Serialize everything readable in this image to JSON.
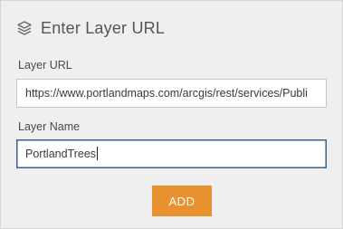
{
  "header": {
    "icon": "layers-icon",
    "title": "Enter Layer URL"
  },
  "form": {
    "url_label": "Layer URL",
    "url_value": "https://www.portlandmaps.com/arcgis/rest/services/Publi",
    "name_label": "Layer Name",
    "name_value": "PortlandTrees"
  },
  "actions": {
    "add_label": "ADD"
  },
  "colors": {
    "panel_background": "#efefef",
    "accent_button": "#e8922f",
    "focused_border": "#3b5f8f"
  }
}
